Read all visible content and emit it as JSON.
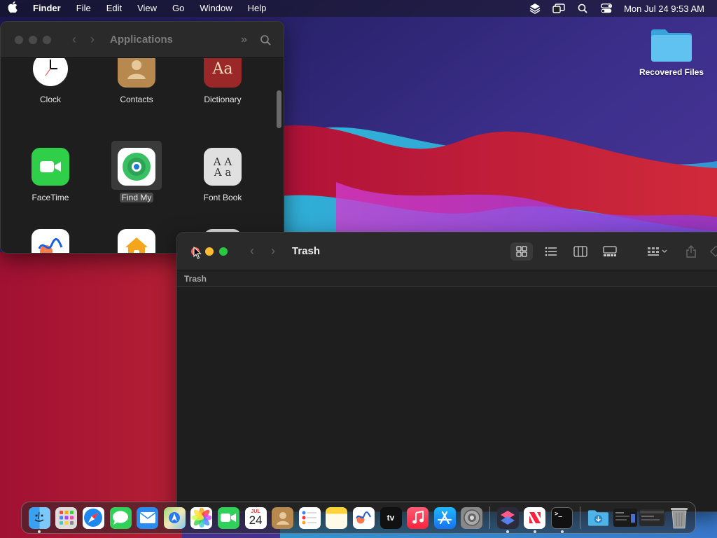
{
  "menubar": {
    "app_name": "Finder",
    "menus": [
      "File",
      "Edit",
      "View",
      "Go",
      "Window",
      "Help"
    ],
    "clock": "Mon Jul 24  9:53 AM",
    "status_icons": [
      "stack-icon",
      "screen-mirroring-icon",
      "spotlight-icon",
      "control-center-icon"
    ]
  },
  "desktop": {
    "folder_label": "Recovered Files",
    "folder_color": "#4fb3e8"
  },
  "apps_window": {
    "title": "Applications",
    "apps": [
      {
        "label": "Clock",
        "icon": "clock-icon"
      },
      {
        "label": "Contacts",
        "icon": "contacts-icon"
      },
      {
        "label": "Dictionary",
        "icon": "dictionary-icon"
      },
      {
        "label": "FaceTime",
        "icon": "facetime-icon"
      },
      {
        "label": "Find My",
        "icon": "find-my-icon",
        "selected": true
      },
      {
        "label": "Font Book",
        "icon": "font-book-icon"
      },
      {
        "label": "",
        "icon": "freeform-icon"
      },
      {
        "label": "",
        "icon": "home-icon"
      },
      {
        "label": "",
        "icon": "image-capture-icon"
      }
    ]
  },
  "trash_window": {
    "title": "Trash",
    "path": "Trash",
    "view_modes": [
      "icon-view",
      "list-view",
      "column-view",
      "gallery-view"
    ],
    "active_view": "icon-view"
  },
  "dock": {
    "apps": [
      {
        "name": "finder-icon",
        "running": true
      },
      {
        "name": "launchpad-icon",
        "running": false
      },
      {
        "name": "safari-icon",
        "running": false
      },
      {
        "name": "messages-icon",
        "running": false
      },
      {
        "name": "mail-icon",
        "running": false
      },
      {
        "name": "maps-icon",
        "running": false
      },
      {
        "name": "photos-icon",
        "running": false
      },
      {
        "name": "facetime-icon",
        "running": false
      },
      {
        "name": "calendar-icon",
        "running": false,
        "month": "JUL",
        "day": "24"
      },
      {
        "name": "contacts-icon",
        "running": false
      },
      {
        "name": "reminders-icon",
        "running": false
      },
      {
        "name": "notes-icon",
        "running": false
      },
      {
        "name": "freeform-icon",
        "running": false
      },
      {
        "name": "apple-tv-icon",
        "running": false,
        "text": "tv"
      },
      {
        "name": "music-icon",
        "running": false
      },
      {
        "name": "app-store-icon",
        "running": false
      },
      {
        "name": "system-settings-icon",
        "running": false
      }
    ],
    "recent": [
      {
        "name": "shortcuts-icon",
        "running": true
      },
      {
        "name": "news-icon",
        "running": true
      },
      {
        "name": "terminal-icon",
        "running": true
      }
    ],
    "stacks": [
      {
        "name": "downloads-folder-icon"
      },
      {
        "name": "window-thumbnail-icon"
      },
      {
        "name": "window-thumbnail-icon"
      },
      {
        "name": "trash-icon"
      }
    ]
  }
}
